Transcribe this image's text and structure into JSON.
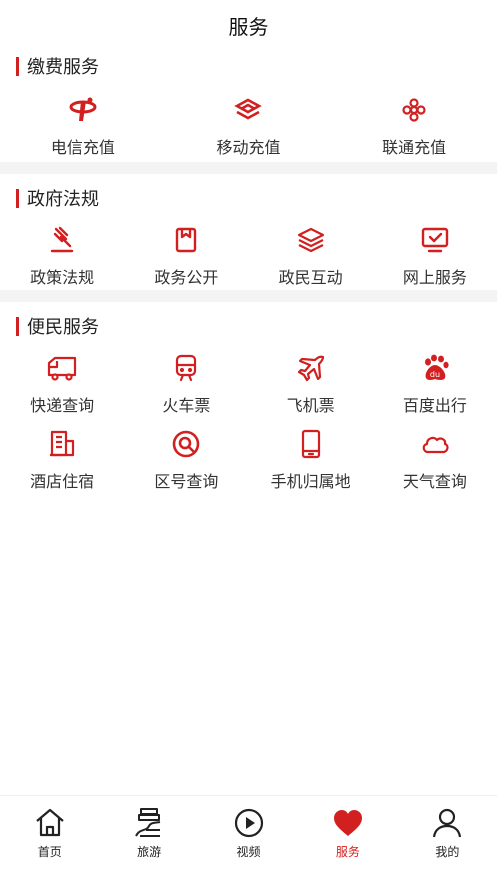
{
  "header": {
    "title": "服务"
  },
  "accent": "#d21f1f",
  "sections": {
    "pay": {
      "title": "缴费服务",
      "items": [
        {
          "label": "电信充值",
          "icon": "china-telecom-icon"
        },
        {
          "label": "移动充值",
          "icon": "china-mobile-icon"
        },
        {
          "label": "联通充值",
          "icon": "china-unicom-icon"
        }
      ]
    },
    "gov": {
      "title": "政府法规",
      "items": [
        {
          "label": "政策法规",
          "icon": "gavel-icon"
        },
        {
          "label": "政务公开",
          "icon": "bookmark-icon"
        },
        {
          "label": "政民互动",
          "icon": "layers-icon"
        },
        {
          "label": "网上服务",
          "icon": "monitor-icon"
        }
      ]
    },
    "life": {
      "title": "便民服务",
      "items": [
        {
          "label": "快递查询",
          "icon": "truck-icon"
        },
        {
          "label": "火车票",
          "icon": "train-icon"
        },
        {
          "label": "飞机票",
          "icon": "airplane-icon"
        },
        {
          "label": "百度出行",
          "icon": "baidu-paw-icon"
        },
        {
          "label": "酒店住宿",
          "icon": "building-icon"
        },
        {
          "label": "区号查询",
          "icon": "search-icon"
        },
        {
          "label": "手机归属地",
          "icon": "phone-icon"
        },
        {
          "label": "天气查询",
          "icon": "cloud-icon"
        }
      ]
    }
  },
  "tabbar": {
    "tabs": [
      {
        "label": "首页",
        "icon": "home-icon",
        "active": false
      },
      {
        "label": "旅游",
        "icon": "travel-icon",
        "active": false
      },
      {
        "label": "视频",
        "icon": "play-icon",
        "active": false
      },
      {
        "label": "服务",
        "icon": "heart-icon",
        "active": true
      },
      {
        "label": "我的",
        "icon": "user-icon",
        "active": false
      }
    ]
  }
}
